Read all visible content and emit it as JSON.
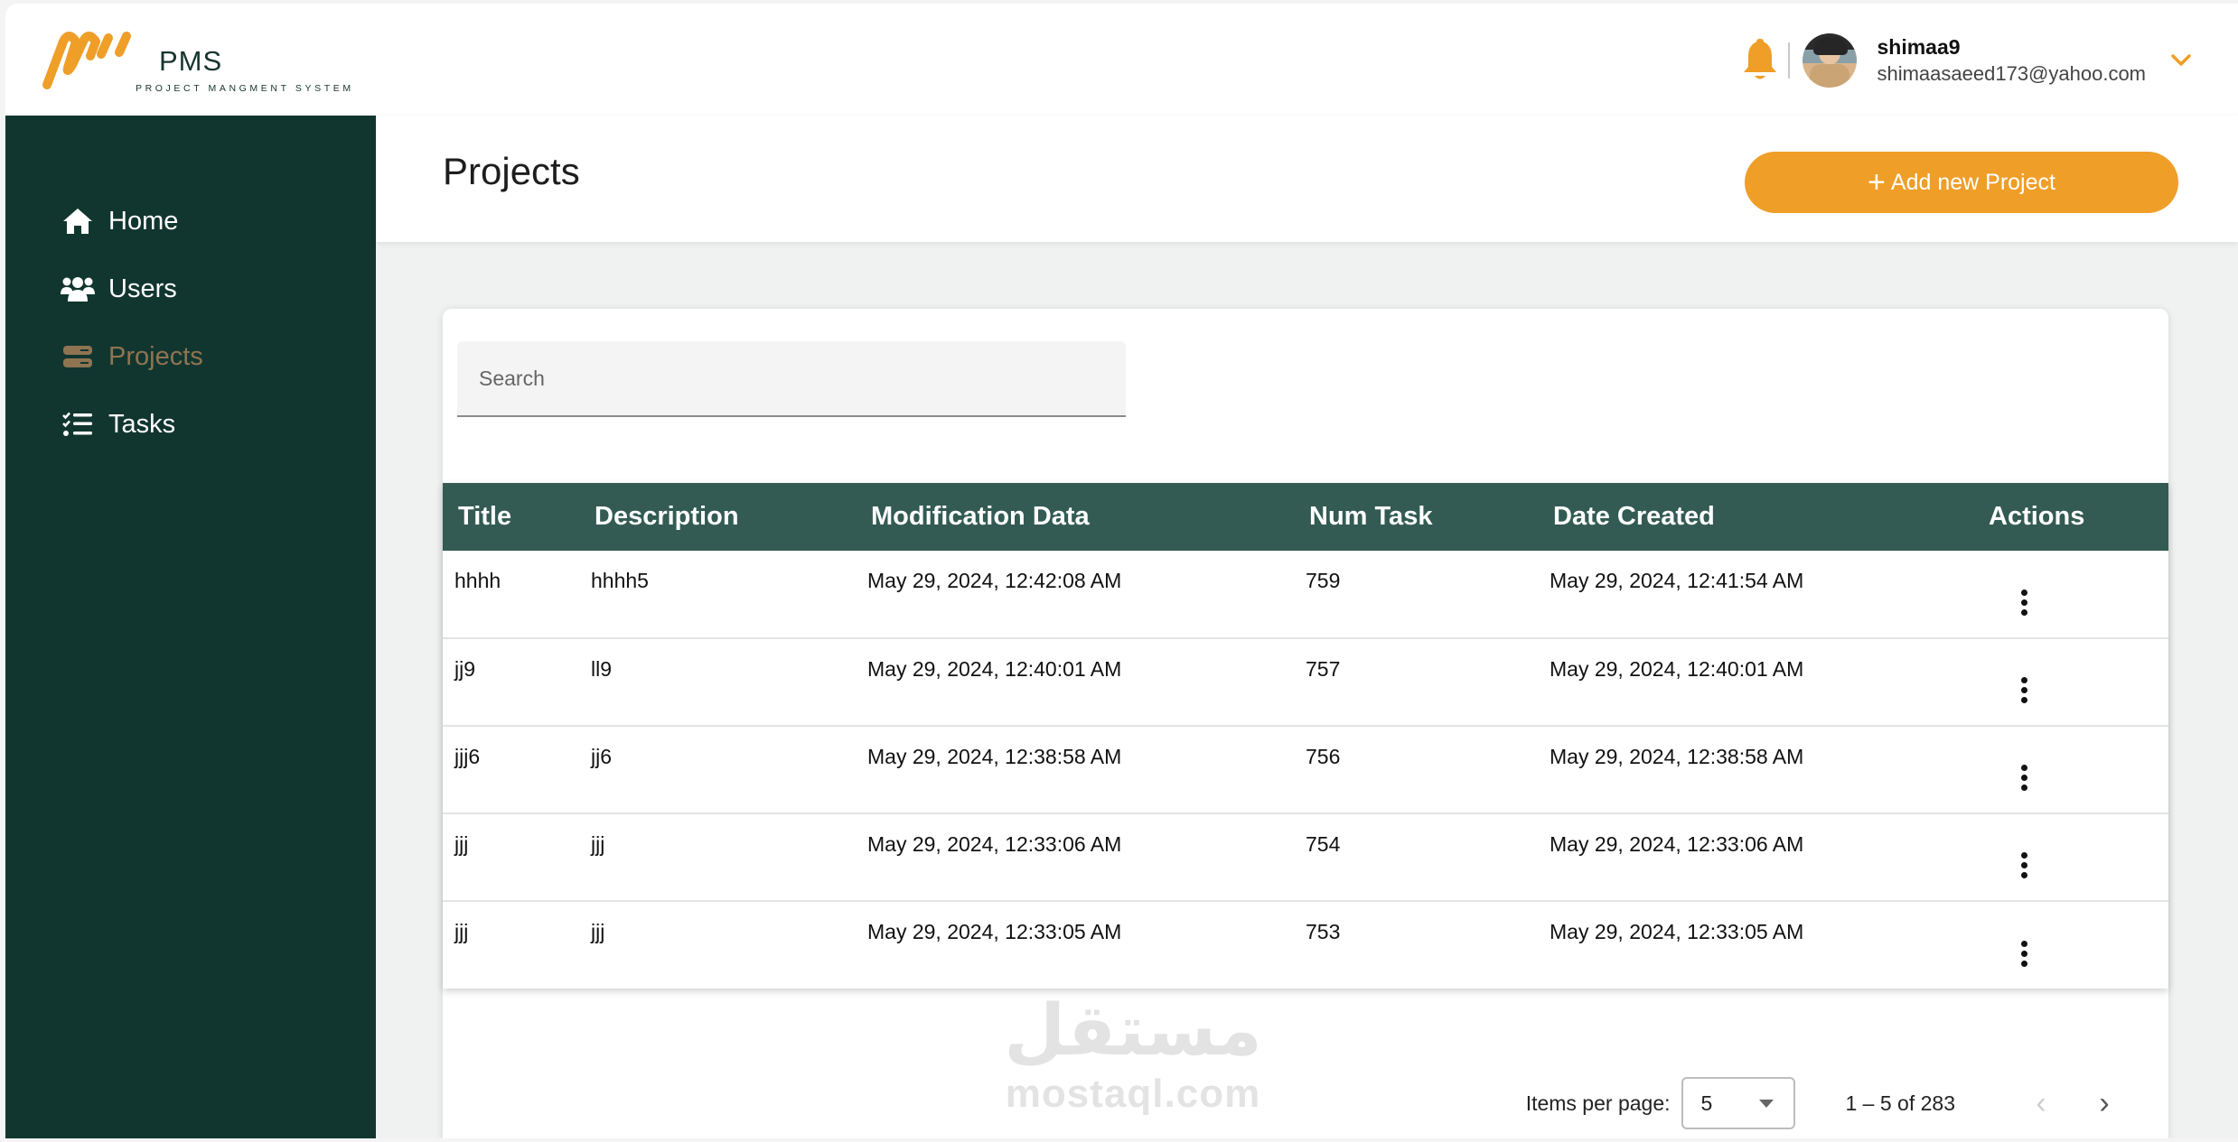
{
  "brand": {
    "name": "PMS",
    "subtitle": "PROJECT MANGMENT SYSTEM",
    "accent_color": "#ef9e28",
    "sidebar_color": "#11362f",
    "table_header_color": "#335b53"
  },
  "user": {
    "name": "shimaa9",
    "email": "shimaasaeed173@yahoo.com",
    "notification_icon": "bell-icon",
    "menu_icon": "chevron-down-icon"
  },
  "sidebar": {
    "items": [
      {
        "label": "Home",
        "icon": "home-icon",
        "active": false
      },
      {
        "label": "Users",
        "icon": "users-icon",
        "active": false
      },
      {
        "label": "Projects",
        "icon": "projects-icon",
        "active": true
      },
      {
        "label": "Tasks",
        "icon": "tasks-icon",
        "active": false
      }
    ]
  },
  "header": {
    "title": "Projects",
    "add_button_label": "Add new Project",
    "add_button_icon": "+"
  },
  "search": {
    "placeholder": "Search",
    "value": ""
  },
  "table": {
    "columns": [
      "Title",
      "Description",
      "Modification Data",
      "Num Task",
      "Date Created",
      "Actions"
    ],
    "rows": [
      {
        "title": "hhhh",
        "description": "hhhh5",
        "modified": "May 29, 2024, 12:42:08 AM",
        "num_task": "759",
        "created": "May 29, 2024, 12:41:54 AM"
      },
      {
        "title": "jj9",
        "description": "ll9",
        "modified": "May 29, 2024, 12:40:01 AM",
        "num_task": "757",
        "created": "May 29, 2024, 12:40:01 AM"
      },
      {
        "title": "jjj6",
        "description": "jj6",
        "modified": "May 29, 2024, 12:38:58 AM",
        "num_task": "756",
        "created": "May 29, 2024, 12:38:58 AM"
      },
      {
        "title": "jjj",
        "description": "jjj",
        "modified": "May 29, 2024, 12:33:06 AM",
        "num_task": "754",
        "created": "May 29, 2024, 12:33:06 AM"
      },
      {
        "title": "jjj",
        "description": "jjj",
        "modified": "May 29, 2024, 12:33:05 AM",
        "num_task": "753",
        "created": "May 29, 2024, 12:33:05 AM"
      }
    ]
  },
  "paginator": {
    "items_per_page_label": "Items per page:",
    "items_per_page": "5",
    "range_label": "1 – 5 of 283",
    "prev_icon": "‹",
    "next_icon": "›"
  },
  "watermark": {
    "arabic": "مستقل",
    "latin": "mostaql.com"
  }
}
